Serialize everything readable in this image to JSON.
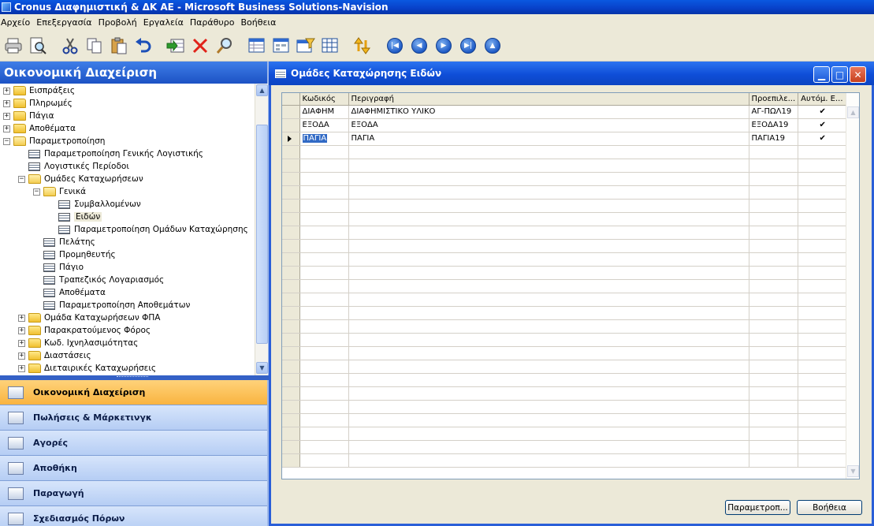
{
  "app": {
    "title": "Cronus Διαφημιστική & ΔΚ ΑΕ - Microsoft Business Solutions-Navision"
  },
  "menu": [
    "Αρχείο",
    "Επεξεργασία",
    "Προβολή",
    "Εργαλεία",
    "Παράθυρο",
    "Βοήθεια"
  ],
  "toolbar": {
    "icons": [
      "print-icon",
      "print-preview-icon",
      "cut-icon",
      "copy-icon",
      "paste-icon",
      "undo-icon",
      "insert-icon",
      "delete-icon",
      "find-icon",
      "list-icon",
      "card-icon",
      "filter-icon",
      "table-icon",
      "sort-icon",
      "first-record-icon",
      "previous-record-icon",
      "next-record-icon",
      "last-record-icon",
      "lookup-icon"
    ]
  },
  "navpane": {
    "header": "Οικονομική Διαχείριση",
    "tree": [
      {
        "label": "Εισπράξεις",
        "level": 0,
        "kind": "folder",
        "exp": "+"
      },
      {
        "label": "Πληρωμές",
        "level": 0,
        "kind": "folder",
        "exp": "+"
      },
      {
        "label": "Πάγια",
        "level": 0,
        "kind": "folder",
        "exp": "+"
      },
      {
        "label": "Αποθέματα",
        "level": 0,
        "kind": "folder",
        "exp": "+"
      },
      {
        "label": "Παραμετροποίηση",
        "level": 0,
        "kind": "folder-open",
        "exp": "−"
      },
      {
        "label": "Παραμετροποίηση Γενικής Λογιστικής",
        "level": 1,
        "kind": "form"
      },
      {
        "label": "Λογιστικές Περίοδοι",
        "level": 1,
        "kind": "form"
      },
      {
        "label": "Ομάδες Καταχωρήσεων",
        "level": 1,
        "kind": "folder-open",
        "exp": "−"
      },
      {
        "label": "Γενικά",
        "level": 2,
        "kind": "folder-open",
        "exp": "−"
      },
      {
        "label": "Συμβαλλομένων",
        "level": 3,
        "kind": "form"
      },
      {
        "label": "Ειδών",
        "level": 3,
        "kind": "form",
        "selected": true
      },
      {
        "label": "Παραμετροποίηση Ομάδων Καταχώρησης",
        "level": 3,
        "kind": "form"
      },
      {
        "label": "Πελάτης",
        "level": 2,
        "kind": "form"
      },
      {
        "label": "Προμηθευτής",
        "level": 2,
        "kind": "form"
      },
      {
        "label": "Πάγιο",
        "level": 2,
        "kind": "form"
      },
      {
        "label": "Τραπεζικός Λογαριασμός",
        "level": 2,
        "kind": "form"
      },
      {
        "label": "Αποθέματα",
        "level": 2,
        "kind": "form"
      },
      {
        "label": "Παραμετροποίηση Αποθεμάτων",
        "level": 2,
        "kind": "form"
      },
      {
        "label": "Ομάδα Καταχωρήσεων ΦΠΑ",
        "level": 1,
        "kind": "folder",
        "exp": "+"
      },
      {
        "label": "Παρακρατούμενος Φόρος",
        "level": 1,
        "kind": "folder",
        "exp": "+"
      },
      {
        "label": "Κωδ. Ιχνηλασιμότητας",
        "level": 1,
        "kind": "folder",
        "exp": "+"
      },
      {
        "label": "Διαστάσεις",
        "level": 1,
        "kind": "folder",
        "exp": "+"
      },
      {
        "label": "Διεταιρικές Καταχωρήσεις",
        "level": 1,
        "kind": "folder",
        "exp": "+"
      }
    ],
    "buttons": [
      {
        "label": "Οικονομική Διαχείριση",
        "active": true,
        "icon": "finance-icon"
      },
      {
        "label": "Πωλήσεις & Μάρκετινγκ",
        "active": false,
        "icon": "sales-icon"
      },
      {
        "label": "Αγορές",
        "active": false,
        "icon": "purchases-icon"
      },
      {
        "label": "Αποθήκη",
        "active": false,
        "icon": "warehouse-icon"
      },
      {
        "label": "Παραγωγή",
        "active": false,
        "icon": "manufacturing-icon"
      },
      {
        "label": "Σχεδιασμός Πόρων",
        "active": false,
        "icon": "resource-planning-icon"
      }
    ]
  },
  "window": {
    "title": "Ομάδες Καταχώρησης Ειδών",
    "columns": [
      "Κωδικός",
      "Περιγραφή",
      "Προεπιλε...",
      "Αυτόμ. Ε..."
    ],
    "rows": [
      {
        "code": "ΔΙΑΦΗΜ",
        "description": "ΔΙΑΦΗΜΙΣΤΙΚΟ ΥΛΙΚΟ",
        "default": "ΑΓ-ΠΩΛ19",
        "auto": "✔"
      },
      {
        "code": "ΕΞΟΔΑ",
        "description": "ΕΞΟΔΑ",
        "default": "ΕΞΟΔΑ19",
        "auto": "✔"
      },
      {
        "code": "ΠΑΓΙΑ",
        "description": "ΠΑΓΙΑ",
        "default": "ΠΑΓΙΑ19",
        "auto": "✔"
      }
    ],
    "current_row": 2,
    "buttons": {
      "setup": "Παραμετροπ...",
      "help": "Βοήθεια"
    }
  }
}
